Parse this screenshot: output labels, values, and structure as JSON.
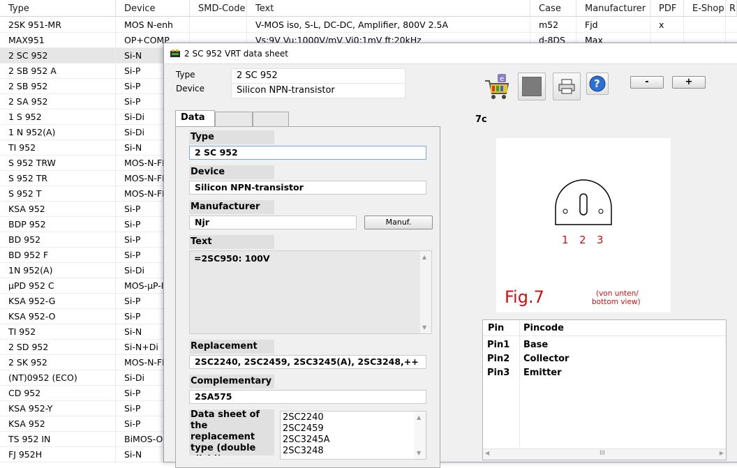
{
  "list": {
    "columns": [
      "Type",
      "Device",
      "SMD-Code",
      "Text",
      "Case",
      "Manufacturer",
      "PDF",
      "E-Shop",
      "R"
    ],
    "rows": [
      {
        "type": "2SK 951-MR",
        "device": "MOS N-enh",
        "smd": "",
        "text": "V-MOS iso, S-L, DC-DC, Amplifier, 800V 2.5A",
        "case": "m52",
        "manufacturer": "Fjd",
        "pdf": "x"
      },
      {
        "type": "MAX951",
        "device": "OP+COMP",
        "smd": "",
        "text": "Vs:9V Vu:1000V/mV Vi0:1mV ft:20kHz",
        "case": "d-8DS",
        "manufacturer": "Max",
        "pdf": ""
      },
      {
        "type": "2 SC 952",
        "device": "Si-N"
      },
      {
        "type": "2 SB 952 A",
        "device": "Si-P"
      },
      {
        "type": "2 SB 952",
        "device": "Si-P"
      },
      {
        "type": "2 SA 952",
        "device": "Si-P"
      },
      {
        "type": "1 S 952",
        "device": "Si-Di"
      },
      {
        "type": "1 N 952(A)",
        "device": "Si-Di"
      },
      {
        "type": "TI 952",
        "device": "Si-N"
      },
      {
        "type": "S 952 TRW",
        "device": "MOS-N-FE"
      },
      {
        "type": "S 952 TR",
        "device": "MOS-N-FE"
      },
      {
        "type": "S 952 T",
        "device": "MOS-N-FE"
      },
      {
        "type": "KSA 952",
        "device": "Si-P"
      },
      {
        "type": "BDP 952",
        "device": "Si-P"
      },
      {
        "type": "BD 952",
        "device": "Si-P"
      },
      {
        "type": "BD 952 F",
        "device": "Si-P"
      },
      {
        "type": "1N 952(A)",
        "device": "Si-Di"
      },
      {
        "type": "µPD 952 C",
        "device": "MOS-µP-IC"
      },
      {
        "type": "KSA 952-G",
        "device": "Si-P"
      },
      {
        "type": "KSA 952-O",
        "device": "Si-P"
      },
      {
        "type": "TI 952",
        "device": "Si-N"
      },
      {
        "type": "2 SD 952",
        "device": "Si-N+Di"
      },
      {
        "type": "2 SK 952",
        "device": "MOS-N-FE"
      },
      {
        "type": "(NT)0952 (ECO)",
        "device": "Si-Di"
      },
      {
        "type": "CD 952",
        "device": "Si-P"
      },
      {
        "type": "KSA 952-Y",
        "device": "Si-P"
      },
      {
        "type": "KSA 952",
        "device": "Si-P"
      },
      {
        "type": "TS 952 IN",
        "device": "BiMOS-OP"
      },
      {
        "type": "FJ 952H",
        "device": "Si-N"
      }
    ],
    "selected_index": 2
  },
  "window": {
    "title": "2 SC 952 VRT data sheet",
    "header": {
      "type_label": "Type",
      "type_value": "2 SC 952",
      "device_label": "Device",
      "device_value": "Silicon NPN-transistor"
    },
    "tabs": [
      "Data",
      "",
      ""
    ],
    "fields": {
      "type_label": "Type",
      "type_value": "2 SC 952",
      "device_label": "Device",
      "device_value": "Silicon NPN-transistor",
      "manufacturer_label": "Manufacturer",
      "manufacturer_value": "Njr",
      "manuf_button": "Manuf.",
      "text_label": "Text",
      "text_value": "=2SC950: 100V",
      "replacement_label": "Replacement",
      "replacement_value": "2SC2240, 2SC2459, 2SC3245(A), 2SC3248,++",
      "complementary_label": "Complementary",
      "complementary_value": "2SA575",
      "datasheet_label": "Data sheet of the replacement type (double click!)",
      "datasheet_items": [
        "2SC2240",
        "2SC2459",
        "2SC3245A",
        "2SC3248"
      ]
    },
    "toolbar": {
      "minus": "-",
      "plus": "+",
      "icons": [
        "shopping-cart-icon",
        "color-swatch-icon",
        "print-icon",
        "help-icon"
      ],
      "swatch_color": "#7b7b7b"
    },
    "case_code": "7c",
    "figure": {
      "pins": [
        "1",
        "2",
        "3"
      ],
      "caption": "Fig.7",
      "note_line1": "(von unten/",
      "note_line2": "bottom view)",
      "red": "#cc1111"
    },
    "pins": {
      "header_pin": "Pin",
      "header_code": "Pincode",
      "rows": [
        {
          "pin": "Pin1",
          "code": "Base"
        },
        {
          "pin": "Pin2",
          "code": "Collector"
        },
        {
          "pin": "Pin3",
          "code": "Emitter"
        }
      ],
      "scroll_glyph": "III"
    }
  }
}
